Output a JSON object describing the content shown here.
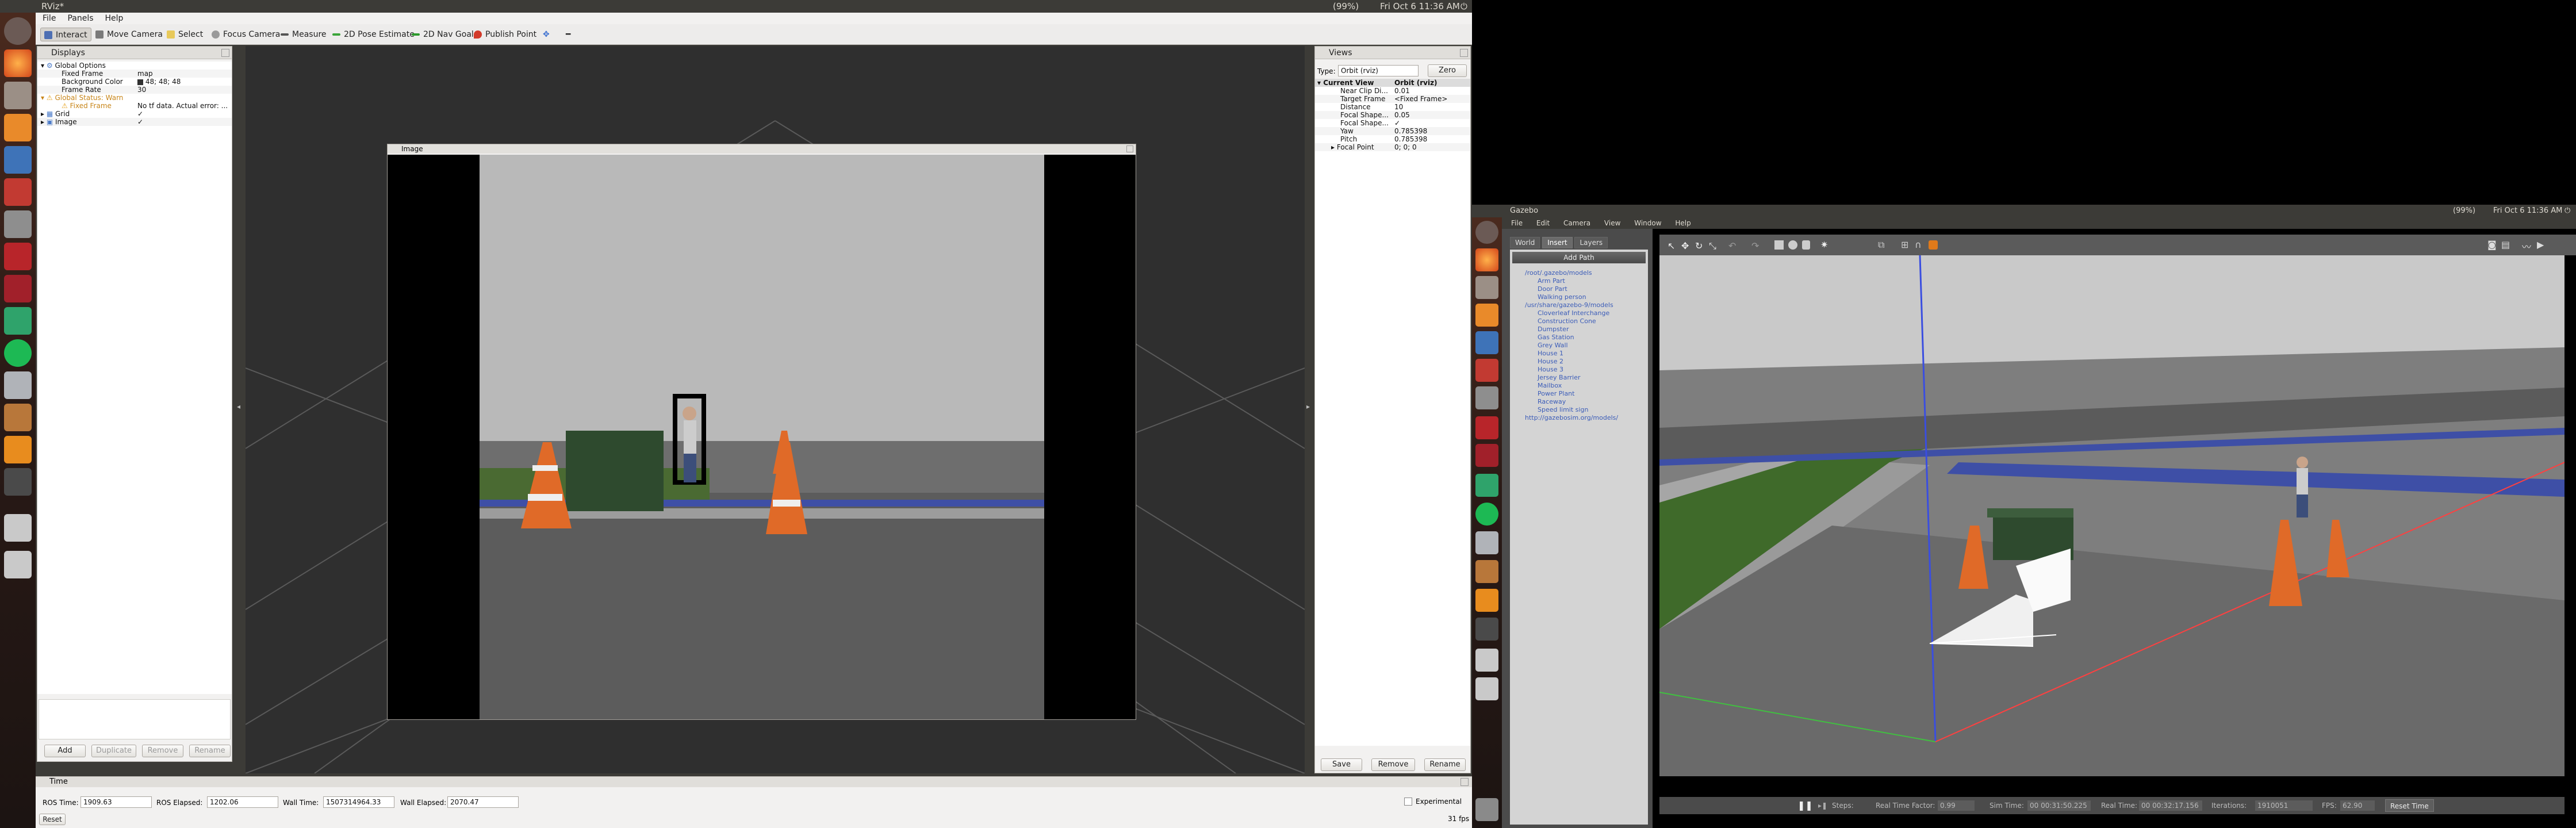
{
  "rviz": {
    "window_title": "RViz*",
    "topbar": {
      "status": "(99%)",
      "clock": "Fri Oct 6 11:36 AM"
    },
    "menu": [
      "File",
      "Panels",
      "Help"
    ],
    "toolbar": [
      "Interact",
      "Move Camera",
      "Select",
      "Focus Camera",
      "Measure",
      "2D Pose Estimate",
      "2D Nav Goal",
      "Publish Point"
    ],
    "displays": {
      "title": "Displays",
      "rows": [
        {
          "label": "Global Options",
          "value": ""
        },
        {
          "label": "Fixed Frame",
          "value": "map"
        },
        {
          "label": "Background Color",
          "value": "48; 48; 48"
        },
        {
          "label": "Frame Rate",
          "value": "30"
        },
        {
          "label": "Global Status: Warn",
          "value": ""
        },
        {
          "label": "Fixed Frame",
          "value": "No tf data.  Actual error: ..."
        },
        {
          "label": "Grid",
          "value": "✓"
        },
        {
          "label": "Image",
          "value": "✓"
        }
      ],
      "buttons": [
        "Add",
        "Duplicate",
        "Remove",
        "Rename"
      ]
    },
    "image_panel_title": "Image",
    "views": {
      "title": "Views",
      "type_label": "Type:",
      "type_value": "Orbit (rviz)",
      "zero_button": "Zero",
      "rows": [
        {
          "label": "Current View",
          "value": "Orbit (rviz)"
        },
        {
          "label": "Near Clip Di...",
          "value": "0.01"
        },
        {
          "label": "Target Frame",
          "value": "<Fixed Frame>"
        },
        {
          "label": "Distance",
          "value": "10"
        },
        {
          "label": "Focal Shape...",
          "value": "0.05"
        },
        {
          "label": "Focal Shape...",
          "value": "✓"
        },
        {
          "label": "Yaw",
          "value": "0.785398"
        },
        {
          "label": "Pitch",
          "value": "0.785398"
        },
        {
          "label": "Focal Point",
          "value": "0; 0; 0"
        }
      ],
      "buttons": [
        "Save",
        "Remove",
        "Rename"
      ]
    },
    "time": {
      "title": "Time",
      "ros_time_label": "ROS Time:",
      "ros_time": "1909.63",
      "ros_elapsed_label": "ROS Elapsed:",
      "ros_elapsed": "1202.06",
      "wall_time_label": "Wall Time:",
      "wall_time": "1507314964.33",
      "wall_elapsed_label": "Wall Elapsed:",
      "wall_elapsed": "2070.47",
      "experimental": "Experimental",
      "reset": "Reset",
      "fps": "31 fps"
    }
  },
  "gazebo": {
    "title": "Gazebo",
    "topbar": {
      "status": "(99%)",
      "clock": "Fri Oct 6 11:36 AM"
    },
    "menu": [
      "File",
      "Edit",
      "Camera",
      "View",
      "Window",
      "Help"
    ],
    "tabs": [
      "World",
      "Insert",
      "Layers"
    ],
    "add_path": "Add Path",
    "tree": [
      "/root/.gazebo/models",
      "Arm Part",
      "Door Part",
      "Walking person",
      "/usr/share/gazebo-9/models",
      "Cloverleaf Interchange",
      "Construction Cone",
      "Dumpster",
      "Gas Station",
      "Grey Wall",
      "House 1",
      "House 2",
      "House 3",
      "Jersey Barrier",
      "Mailbox",
      "Power Plant",
      "Raceway",
      "Speed limit sign",
      "http://gazebosim.org/models/"
    ],
    "bottom": {
      "steps": "Steps:",
      "rtf_label": "Real Time Factor:",
      "rtf": "0.99",
      "sim_label": "Sim Time:",
      "sim": "00 00:31:50.225",
      "real_label": "Real Time:",
      "real": "00 00:32:17.156",
      "iter_label": "Iterations:",
      "iter": "1910051",
      "fps_label": "FPS:",
      "fps": "62.90",
      "reset": "Reset Time"
    }
  }
}
